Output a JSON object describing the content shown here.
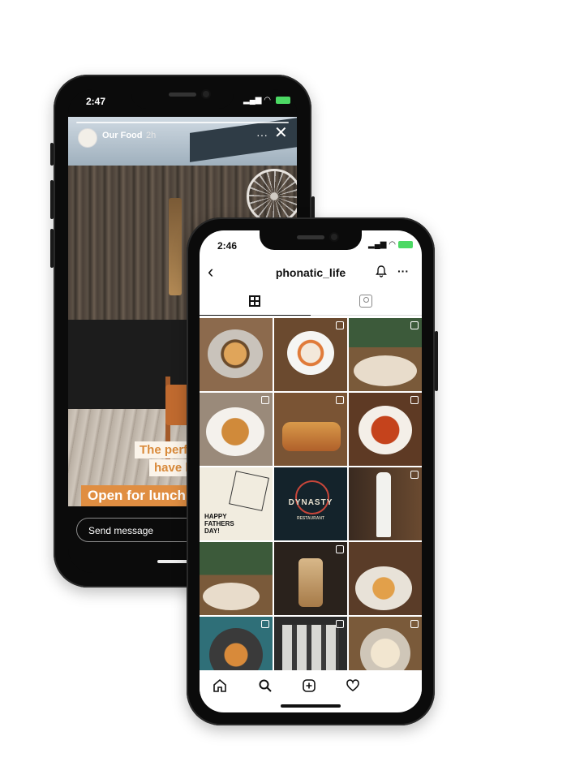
{
  "back_phone": {
    "status_time": "2:47",
    "status_icons": "▪▪▪ ◠",
    "story": {
      "username": "Our Food",
      "time_ago": "2h",
      "more_icon": "···",
      "close_icon": "✕",
      "caption_line1": "The perfe",
      "caption_line2": "have lun",
      "caption_banner": "Open for lunch",
      "reply_placeholder": "Send message"
    }
  },
  "front_phone": {
    "status_time": "2:46",
    "status_icons": "▪▪▪ ◠",
    "header": {
      "back_icon": "‹",
      "username": "phonatic_life",
      "bell_icon": "🔔",
      "more_icon": "···"
    },
    "tabs": [
      {
        "name": "grid",
        "icon": "grid-icon",
        "active": true
      },
      {
        "name": "tagged",
        "icon": "tagged-icon",
        "active": false
      }
    ],
    "grid_posts": {
      "fathers_day_text": "HAPPY FATHERS DAY!",
      "dynasty_title": "DYNASTY",
      "dynasty_sub": "RESTAURANT"
    },
    "bottom_nav": {
      "home_icon": "⌂",
      "search_icon": "⚲",
      "add_icon": "⊞",
      "heart_icon": "♡"
    }
  },
  "colors": {
    "story_caption": "#d98a3a",
    "story_banner_bg": "#e08e42",
    "battery": "#4cd964"
  }
}
